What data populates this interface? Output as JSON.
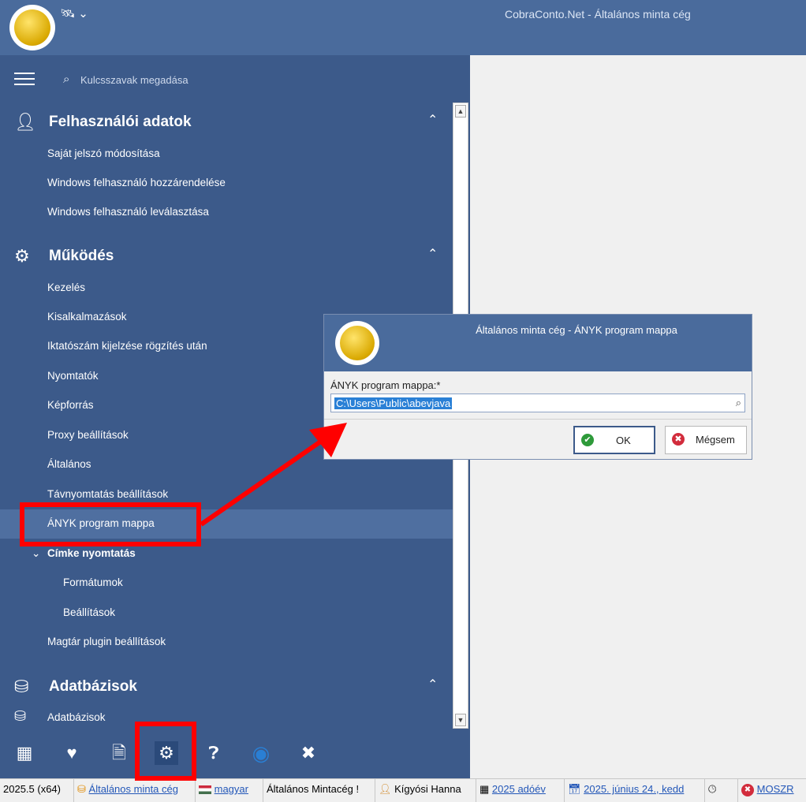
{
  "titlebar": {
    "title": "CobraConto.Net - Általános minta cég",
    "tools_icon": "satellite-icon"
  },
  "search": {
    "placeholder": "Kulcsszavak megadása"
  },
  "sections": {
    "user": {
      "title": "Felhasználói adatok",
      "icon": "user-key-icon",
      "items": [
        "Saját jelszó módosítása",
        "Windows felhasználó hozzárendelése",
        "Windows felhasználó leválasztása"
      ]
    },
    "ops": {
      "title": "Működés",
      "icon": "gears-icon",
      "items": [
        "Kezelés",
        "Kisalkalmazások",
        "Iktatószám kijelzése rögzítés után",
        "Nyomtatók",
        "Képforrás",
        "Proxy beállítások",
        "Általános",
        "Távnyomtatás beállítások",
        "ÁNYK program mappa"
      ],
      "selected_index": 8
    },
    "label": {
      "title": "Címke nyomtatás",
      "items": [
        "Formátumok",
        "Beállítások"
      ]
    },
    "magtar": {
      "label": "Magtár plugin beállítások"
    },
    "db": {
      "title": "Adatbázisok",
      "icon": "database-icon",
      "items": [
        "Adatbázisok"
      ]
    }
  },
  "bottom_tools": [
    "tree-icon",
    "heart-icon",
    "document-icon",
    "gear-icon",
    "help-icon",
    "teamviewer-icon",
    "close-icon"
  ],
  "dialog": {
    "title": "Általános minta cég - ÁNYK program mappa",
    "field_label": "ÁNYK program mappa:*",
    "field_value": "C:\\Users\\Public\\abevjava",
    "ok_label": "OK",
    "cancel_label": "Mégsem"
  },
  "statusbar": {
    "version": "2025.5 (x64)",
    "company": "Általános minta cég",
    "language": "magyar",
    "company_short": "Általános Mintacég !",
    "user": "Kígyósi Hanna",
    "tax_year": "2025 adóév",
    "date": "2025. június 24., kedd",
    "moszr": "MOSZR"
  },
  "colors": {
    "sidebar": "#3c5a8a",
    "titlebar": "#4a6b9c",
    "highlight": "#ff0000",
    "selection": "#4f6fa0"
  }
}
